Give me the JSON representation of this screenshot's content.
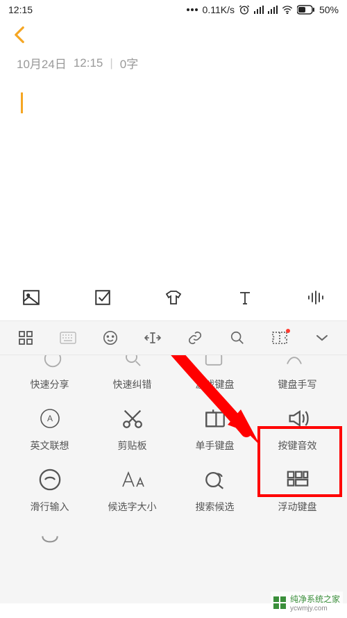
{
  "status": {
    "time": "12:15",
    "net_speed": "0.11K/s",
    "battery_pct": "50%"
  },
  "note": {
    "date": "10月24日",
    "time": "12:15",
    "word_count": "0字"
  },
  "note_actions": {
    "image": "image-icon",
    "checkbox": "checkbox-icon",
    "shirt": "theme-icon",
    "text": "text-format-icon",
    "voice": "voice-wave-icon"
  },
  "kbd_top": {
    "grid": "grid-icon",
    "keyboard": "keyboard-icon",
    "emoji": "emoji-icon",
    "cursor": "cursor-move-icon",
    "link": "link-icon",
    "search": "search-icon",
    "scan": "scan-icon",
    "collapse": "chevron-down-icon"
  },
  "settings_row1": {
    "quick_share": "快速分享",
    "quick_correct": "快速纠错",
    "game_kbd": "游戏键盘",
    "handwriting": "键盘手写"
  },
  "settings_row2": {
    "en_assoc": "英文联想",
    "clipboard": "剪贴板",
    "one_hand": "单手键盘",
    "key_sound": "按键音效"
  },
  "settings_row3": {
    "glide_input": "滑行输入",
    "font_size": "候选字大小",
    "search_cand": "搜索候选",
    "float_kbd": "浮动键盘"
  },
  "watermark": {
    "name": "纯净系统之家",
    "url": "ycwmjy.com"
  },
  "colors": {
    "accent": "#f5a623",
    "annotation": "#ff0000"
  }
}
